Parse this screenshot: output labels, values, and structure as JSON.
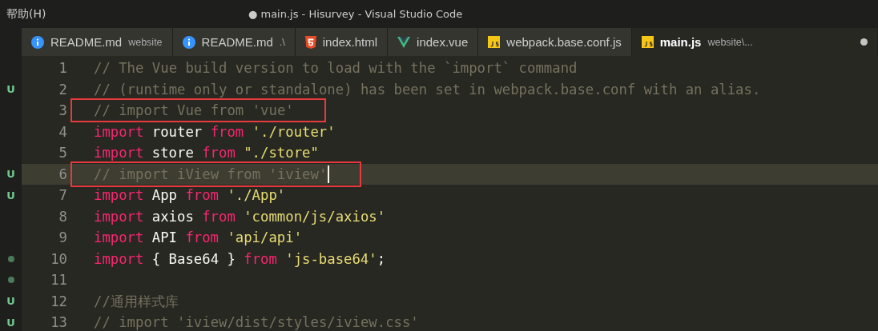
{
  "menu": [
    {
      "label": "帮助(H)"
    }
  ],
  "window": {
    "title": "● main.js - Hisurvey - Visual Studio Code"
  },
  "tabs": [
    {
      "kind": "info",
      "label": "README.md",
      "description": "website",
      "selected": false,
      "modified": false
    },
    {
      "kind": "info",
      "label": "README.md",
      "description": ".\\",
      "selected": false,
      "modified": false
    },
    {
      "kind": "html",
      "label": "index.html",
      "selected": false,
      "modified": false
    },
    {
      "kind": "vue",
      "label": "index.vue",
      "selected": false,
      "modified": false
    },
    {
      "kind": "js",
      "label": "webpack.base.conf.js",
      "selected": false,
      "modified": false
    },
    {
      "kind": "js",
      "label": "main.js",
      "description": "website\\...",
      "selected": true,
      "modified": true
    }
  ],
  "editor": {
    "lines": [
      {
        "number": "1",
        "current": false,
        "boxed": false,
        "tokens": [
          {
            "kind": "comment",
            "text": "// The Vue build version to load with the `import` command"
          }
        ]
      },
      {
        "number": "2",
        "marker": {
          "kind": "letter",
          "text": "U"
        },
        "current": false,
        "boxed": false,
        "tokens": [
          {
            "kind": "comment",
            "text": "// (runtime only or standalone) has been set in webpack.base.conf with an alias."
          }
        ]
      },
      {
        "number": "3",
        "current": false,
        "boxed": true,
        "tokens": [
          {
            "kind": "comment",
            "text": "// import Vue from 'vue'"
          }
        ]
      },
      {
        "number": "4",
        "current": false,
        "boxed": false,
        "tokens": [
          {
            "kind": "keyword",
            "text": "import"
          },
          {
            "kind": "name",
            "text": "router"
          },
          {
            "kind": "keyword",
            "text": "from"
          },
          {
            "kind": "string",
            "text": "'./router'"
          }
        ]
      },
      {
        "number": "5",
        "current": false,
        "boxed": false,
        "tokens": [
          {
            "kind": "keyword",
            "text": "import"
          },
          {
            "kind": "name",
            "text": "store"
          },
          {
            "kind": "keyword",
            "text": "from"
          },
          {
            "kind": "string",
            "text": "\"./store\""
          }
        ]
      },
      {
        "number": "6",
        "marker": {
          "kind": "letter",
          "text": "U"
        },
        "current": true,
        "boxed": true,
        "tokens": [
          {
            "kind": "comment",
            "text": "// import iView from 'iview'"
          }
        ]
      },
      {
        "number": "7",
        "marker": {
          "kind": "letter",
          "text": "U"
        },
        "current": false,
        "boxed": false,
        "tokens": [
          {
            "kind": "keyword",
            "text": "import"
          },
          {
            "kind": "name",
            "text": "App"
          },
          {
            "kind": "keyword",
            "text": "from"
          },
          {
            "kind": "string",
            "text": "'./App'"
          }
        ]
      },
      {
        "number": "8",
        "current": false,
        "boxed": false,
        "tokens": [
          {
            "kind": "keyword",
            "text": "import"
          },
          {
            "kind": "name",
            "text": "axios"
          },
          {
            "kind": "keyword",
            "text": "from"
          },
          {
            "kind": "string",
            "text": "'common/js/axios'"
          }
        ]
      },
      {
        "number": "9",
        "current": false,
        "boxed": false,
        "tokens": [
          {
            "kind": "keyword",
            "text": "import"
          },
          {
            "kind": "name",
            "text": "API"
          },
          {
            "kind": "keyword",
            "text": "from"
          },
          {
            "kind": "string",
            "text": "'api/api'"
          }
        ]
      },
      {
        "number": "10",
        "marker": {
          "kind": "dot"
        },
        "current": false,
        "boxed": false,
        "tokens": [
          {
            "kind": "keyword",
            "text": "import"
          },
          {
            "kind": "name",
            "text": "{ Base64 }"
          },
          {
            "kind": "keyword",
            "text": "from"
          },
          {
            "kind": "string",
            "text": "'js-base64'"
          },
          {
            "kind": "punct",
            "text": ";"
          }
        ]
      },
      {
        "number": "11",
        "marker": {
          "kind": "dot"
        },
        "current": false,
        "boxed": false
      },
      {
        "number": "12",
        "marker": {
          "kind": "letter",
          "text": "U"
        },
        "current": false,
        "boxed": false,
        "tokens": [
          {
            "kind": "comment",
            "text": "//通用样式库"
          }
        ]
      },
      {
        "number": "13",
        "marker": {
          "kind": "letter",
          "text": "U"
        },
        "current": false,
        "boxed": false,
        "tokens": [
          {
            "kind": "comment",
            "text": "// import 'iview/dist/styles/iview.css'"
          }
        ]
      }
    ]
  }
}
